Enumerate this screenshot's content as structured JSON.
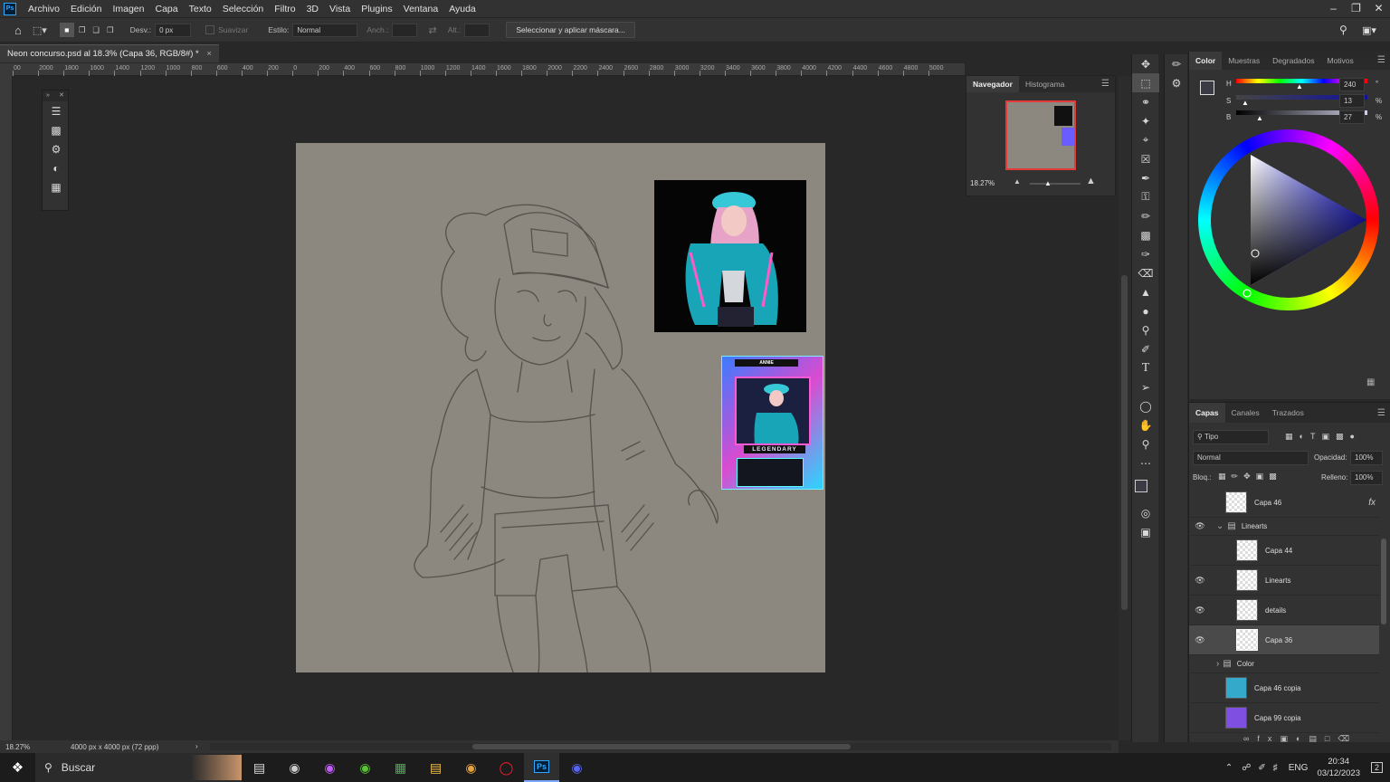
{
  "menubar": {
    "logo": "Ps",
    "items": [
      "Archivo",
      "Edición",
      "Imagen",
      "Capa",
      "Texto",
      "Selección",
      "Filtro",
      "3D",
      "Vista",
      "Plugins",
      "Ventana",
      "Ayuda"
    ],
    "window_controls": [
      "minimize-icon",
      "restore-icon",
      "close-icon"
    ]
  },
  "options": {
    "feather_label": "Desv.:",
    "feather_value": "0 px",
    "antialias_label": "Suavizar",
    "style_label": "Estilo:",
    "style_value": "Normal",
    "width_label": "Anch.:",
    "height_label": "Alt.:",
    "mask_button": "Seleccionar y aplicar máscara..."
  },
  "document": {
    "tab_title": "Neon concurso.psd al 18.3% (Capa 36, RGB/8#) *",
    "close": "×"
  },
  "ruler": {
    "h_labels": [
      "00",
      "2000",
      "1800",
      "1600",
      "1400",
      "1200",
      "1000",
      "800",
      "600",
      "400",
      "200",
      "0",
      "200",
      "400",
      "600",
      "800",
      "1000",
      "1200",
      "1400",
      "1600",
      "1800",
      "2000",
      "2200",
      "2400",
      "2600",
      "2800",
      "3000",
      "3200",
      "3400",
      "3600",
      "3800",
      "4000",
      "4200",
      "4400",
      "4600",
      "4800",
      "5000"
    ]
  },
  "navigator": {
    "tabs": [
      "Navegador",
      "Histograma"
    ],
    "zoom": "18.27%"
  },
  "ref_card": {
    "name": "ANNIE",
    "rarity": "LEGENDARY"
  },
  "color_panel": {
    "tabs": [
      "Color",
      "Muestras",
      "Degradados",
      "Motivos"
    ],
    "h_label": "H",
    "h_value": "240",
    "h_unit": "°",
    "s_label": "S",
    "s_value": "13",
    "s_unit": "%",
    "b_label": "B",
    "b_value": "27",
    "b_unit": "%"
  },
  "layers_panel": {
    "tabs": [
      "Capas",
      "Canales",
      "Trazados"
    ],
    "filter_label": "Tipo",
    "blend_mode": "Normal",
    "opacity_label": "Opacidad:",
    "opacity_value": "100%",
    "lock_label": "Bloq.:",
    "fill_label": "Relleno:",
    "fill_value": "100%",
    "layers": [
      {
        "name": "Capa 46",
        "visible": false,
        "fx": "fx"
      },
      {
        "name": "Linearts",
        "visible": true,
        "group": true
      },
      {
        "name": "Capa 44",
        "visible": false
      },
      {
        "name": "Linearts",
        "visible": true
      },
      {
        "name": "details",
        "visible": true
      },
      {
        "name": "Capa 36",
        "visible": true,
        "selected": true
      },
      {
        "name": "Color",
        "visible": false,
        "group": true
      },
      {
        "name": "Capa 46 copia",
        "visible": false
      },
      {
        "name": "Capa 99 copia",
        "visible": false
      }
    ]
  },
  "status": {
    "zoom": "18.27%",
    "doc_size": "4000 px x 4000 px (72 ppp)"
  },
  "taskbar": {
    "search_label": "Buscar",
    "language": "ENG",
    "time": "20:34",
    "date": "03/12/2023",
    "notifications": "2"
  }
}
